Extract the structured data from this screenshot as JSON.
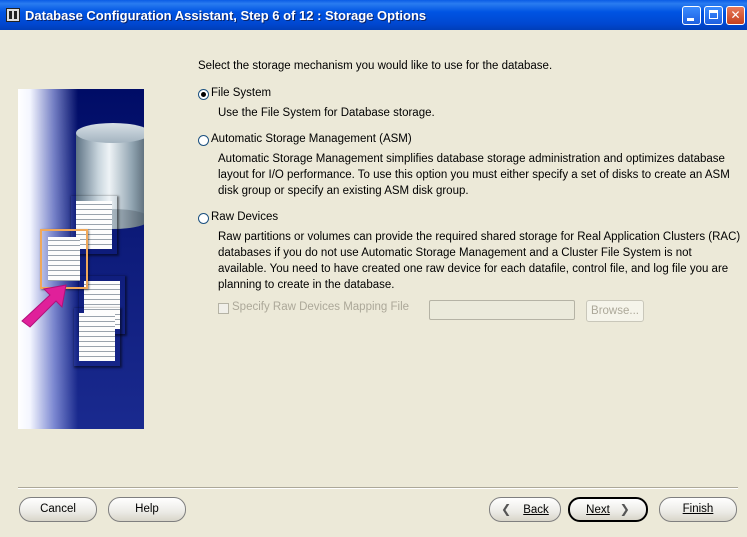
{
  "window": {
    "title": "Database Configuration Assistant, Step 6 of 12 : Storage Options"
  },
  "title_icon": "dbca-app-icon",
  "intro_text": "Select the storage mechanism you would like to use for the database.",
  "options": [
    {
      "label": "File System",
      "description": "Use the File System for Database storage.",
      "selected": true
    },
    {
      "label": "Automatic Storage Management (ASM)",
      "description": "Automatic Storage Management simplifies database storage administration and optimizes database layout for I/O performance. To use this option you must either specify a set of disks to create an ASM disk group or specify an existing ASM disk group.",
      "selected": false
    },
    {
      "label": "Raw Devices",
      "description": "Raw partitions or volumes can provide the required shared storage for Real Application Clusters (RAC) databases if you do not use Automatic Storage Management and a Cluster File System is not available.  You need to have created one raw device for each datafile, control file, and log file you are planning to create in the database.",
      "selected": false
    }
  ],
  "raw_mapping": {
    "checkbox_label": "Specify Raw Devices Mapping File",
    "checked": false,
    "enabled": false,
    "input_value": "",
    "browse_label": "Browse..."
  },
  "footer": {
    "cancel": "Cancel",
    "help": "Help",
    "back": "Back",
    "next": "Next",
    "finish": "Finish"
  },
  "colors": {
    "titlebar": "#0054e3",
    "dialog_bg": "#ece9d8",
    "illustration_bg": "#0d1b7a",
    "arrow": "#e0209a"
  }
}
